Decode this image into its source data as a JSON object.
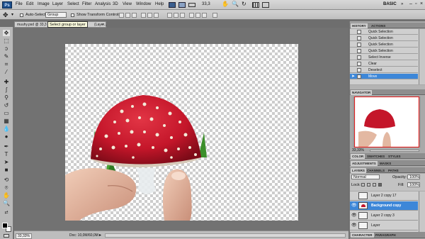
{
  "app": {
    "logo": "Ps",
    "workspace": "BASIC"
  },
  "menu": [
    "File",
    "Edit",
    "Image",
    "Layer",
    "Select",
    "Filter",
    "Analysis",
    "3D",
    "View",
    "Window",
    "Help"
  ],
  "zoom_top": "33,3",
  "options": {
    "auto_select": "Auto-Select:",
    "group_value": "Group",
    "show_transform": "Show Transform Controls"
  },
  "document": {
    "tab_label": "muuhy.psd @ 33,3",
    "tab_suffix": "(Layer...",
    "tooltip": "Select group or layer",
    "zoom": "33,33%",
    "doc_info": "Doc: 10,0M/60,0M"
  },
  "history": {
    "tabs": [
      "HISTORY",
      "ACTIONS"
    ],
    "items": [
      "Quick Selection",
      "Quick Selection",
      "Quick Selection",
      "Quick Selection",
      "Select Inverse",
      "Clear",
      "Deselect",
      "Move"
    ]
  },
  "navigator": {
    "tab": "NAVIGATOR",
    "zoom": "33,33%"
  },
  "color_tabs": [
    "COLOR",
    "SWATCHES",
    "STYLES"
  ],
  "adjust_tabs": [
    "ADJUSTMENTS",
    "MASKS"
  ],
  "layers": {
    "tabs": [
      "LAYERS",
      "CHANNELS",
      "PATHS"
    ],
    "blend": "Normal",
    "opacity_label": "Opacity:",
    "opacity": "100%",
    "lock_label": "Lock:",
    "fill_label": "Fill:",
    "fill": "100%",
    "items": [
      "Layer 2 copy 17",
      "Background copy",
      "Layer 2 copy 3",
      "Layer"
    ]
  },
  "bottom_tabs": [
    "CHARACTER",
    "PARAGRAPH"
  ],
  "colors": {
    "selection": "#3d87d8",
    "cap_red": "#c4162a"
  }
}
